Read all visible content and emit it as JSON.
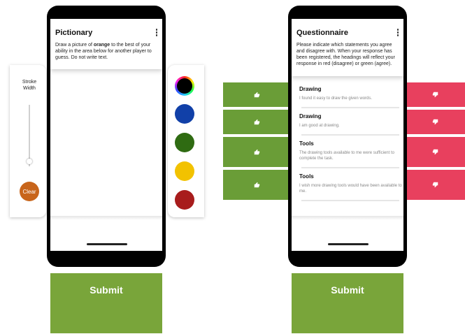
{
  "pictionary": {
    "title": "Pictionary",
    "desc_part1": "Draw a picture of ",
    "target_word": "orange",
    "desc_part2": " to the best of your ability in the area below for another player to guess. Do not write text.",
    "stroke_width_label": "Stroke Width",
    "stroke_width_level": 0.15,
    "clear_label": "Clear",
    "colors": [
      "#000000",
      "#1140a8",
      "#2f6b12",
      "#f2c200",
      "#a81c1c"
    ],
    "selected_color_index": 0,
    "submit_label": "Submit"
  },
  "questionnaire": {
    "title": "Questionnaire",
    "description": "Please indicate which statements you agree and disagree with. When your response has been registered, the headings will reflect your response in red (disagree) or green (agree).",
    "items": [
      {
        "heading": "Drawing",
        "text": "I found it easy to draw the given words."
      },
      {
        "heading": "Drawing",
        "text": "I am good at drawing."
      },
      {
        "heading": "Tools",
        "text": "The drawing tools available to me were sufficient to complete the task."
      },
      {
        "heading": "Tools",
        "text": "I wish more drawing tools would have been available to me."
      }
    ],
    "submit_label": "Submit"
  },
  "colors": {
    "agree": "#6a9d37",
    "disagree": "#e8405e",
    "submit": "#79a53a",
    "clear": "#c8651b"
  },
  "icons": {
    "agree": "thumbs-up-icon",
    "disagree": "thumbs-down-icon",
    "menu": "kebab-menu-icon"
  }
}
